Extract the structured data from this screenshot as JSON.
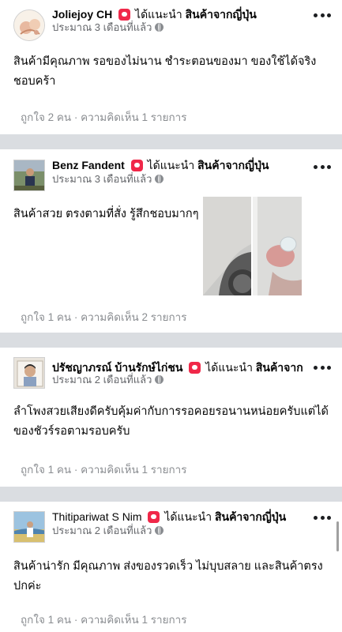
{
  "recommend_verb": "ได้แนะนำ",
  "page_name": "สินค้าจากญี่ปุ่น",
  "reviews": [
    {
      "author": "Joliejoy CH",
      "time": "ประมาณ 3 เดือนที่แล้ว",
      "text_lines": [
        "สินค้ามีคุณภาพ รอของไม่นาน ชำระตอนของมา ของใช้ได้จริง",
        "ชอบคร้า"
      ],
      "stats": "ถูกใจ 2 คน · ความคิดเห็น 1 รายการ"
    },
    {
      "author": "Benz Fandent",
      "time": "ประมาณ 3 เดือนที่แล้ว",
      "text_lines": [
        "สินค้าสวย ตรงตามที่สั่ง รู้สึกชอบมากๆ"
      ],
      "stats": "ถูกใจ 1 คน · ความคิดเห็น 2 รายการ"
    },
    {
      "author": "ปรัชญาภรณ์ บ้านรักษ์ไก่ชน",
      "time": "ประมาณ 2 เดือนที่แล้ว",
      "text_lines": [
        "ลำโพงสวยเสียงดีครับคุ้มค่ากับการรอคอยรอนานหน่อยครับแต่ได้",
        "ของชัวร์รอตามรอบครับ"
      ],
      "stats": "ถูกใจ 1 คน · ความคิดเห็น 1 รายการ"
    },
    {
      "author": "Thitipariwat S Nim",
      "time": "ประมาณ 2 เดือนที่แล้ว",
      "text_lines": [
        "สินค้าน่ารัก มีคุณภาพ ส่งของรวดเร็ว ไม่บุบสลาย และสินค้าตรง",
        "ปกค่ะ"
      ],
      "stats": "ถูกใจ 1 คน · ความคิดเห็น 1 รายการ"
    }
  ]
}
